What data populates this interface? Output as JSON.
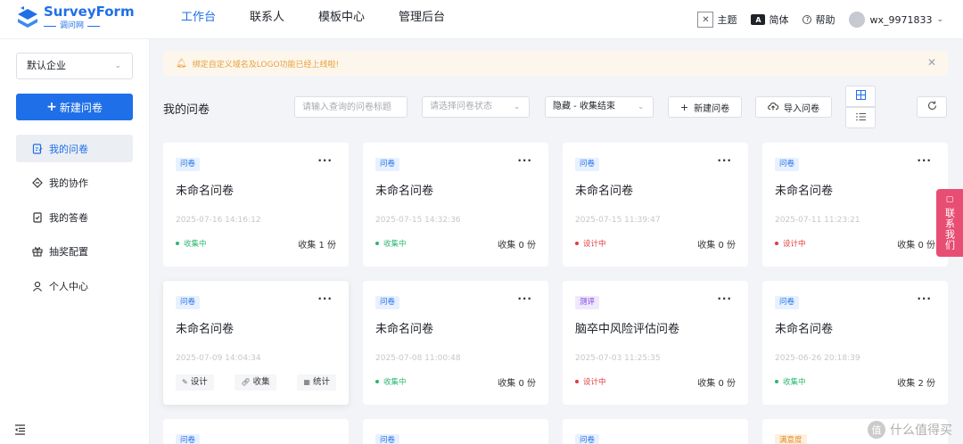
{
  "brand": {
    "name": "SurveyForm",
    "sub": "调问网"
  },
  "nav": [
    "工作台",
    "联系人",
    "模板中心",
    "管理后台"
  ],
  "top_right": {
    "theme": "主题",
    "lang": "简体",
    "help": "帮助",
    "user": "wx_9971833"
  },
  "sidebar": {
    "company": "默认企业",
    "new_button": "新建问卷",
    "items": [
      {
        "label": "我的问卷",
        "icon": "survey-icon"
      },
      {
        "label": "我的协作",
        "icon": "collab-icon"
      },
      {
        "label": "我的答卷",
        "icon": "answer-icon"
      },
      {
        "label": "抽奖配置",
        "icon": "gift-icon"
      },
      {
        "label": "个人中心",
        "icon": "user-icon"
      }
    ]
  },
  "notice": {
    "text": "绑定自定义域名及LOGO功能已经上线啦!"
  },
  "toolbar": {
    "title": "我的问卷",
    "search_placeholder": "请输入查询的问卷标题",
    "status_placeholder": "请选择问卷状态",
    "hide_value": "隐藏 - 收集结束",
    "new_label": "新建问卷",
    "import_label": "导入问卷"
  },
  "cards": [
    {
      "tag": "问卷",
      "title": "未命名问卷",
      "date": "2025-07-16 14:16:12",
      "status": "收集中",
      "count": "收集 1 份"
    },
    {
      "tag": "问卷",
      "title": "未命名问卷",
      "date": "2025-07-15 14:32:36",
      "status": "收集中",
      "count": "收集 0 份"
    },
    {
      "tag": "问卷",
      "title": "未命名问卷",
      "date": "2025-07-15 11:39:47",
      "status": "设计中",
      "count": "收集 0 份"
    },
    {
      "tag": "问卷",
      "title": "未命名问卷",
      "date": "2025-07-11 11:23:21",
      "status": "设计中",
      "count": "收集 0 份"
    },
    {
      "tag": "问卷",
      "title": "未命名问卷",
      "date": "2025-07-09 14:04:34",
      "actions": [
        "设计",
        "收集",
        "统计"
      ]
    },
    {
      "tag": "问卷",
      "title": "未命名问卷",
      "date": "2025-07-08 11:00:48",
      "status": "收集中",
      "count": "收集 0 份"
    },
    {
      "tag": "测评",
      "title": "脑卒中风险评估问卷",
      "date": "2025-07-03 11:25:35",
      "status": "设计中",
      "count": "收集 0 份"
    },
    {
      "tag": "问卷",
      "title": "未命名问卷",
      "date": "2025-06-26 20:18:39",
      "status": "收集中",
      "count": "收集 2 份"
    },
    {
      "tag": "问卷"
    },
    {
      "tag": "问卷"
    },
    {
      "tag": "问卷"
    },
    {
      "tag": "满意度"
    }
  ],
  "contact": "联系我们",
  "watermark": "什么值得买",
  "colors": {
    "primary": "#1f6fe8",
    "collecting": "#2bb673",
    "designing": "#e03c3c",
    "contact": "#e84e73",
    "notice_bg": "#fdf6ec"
  }
}
